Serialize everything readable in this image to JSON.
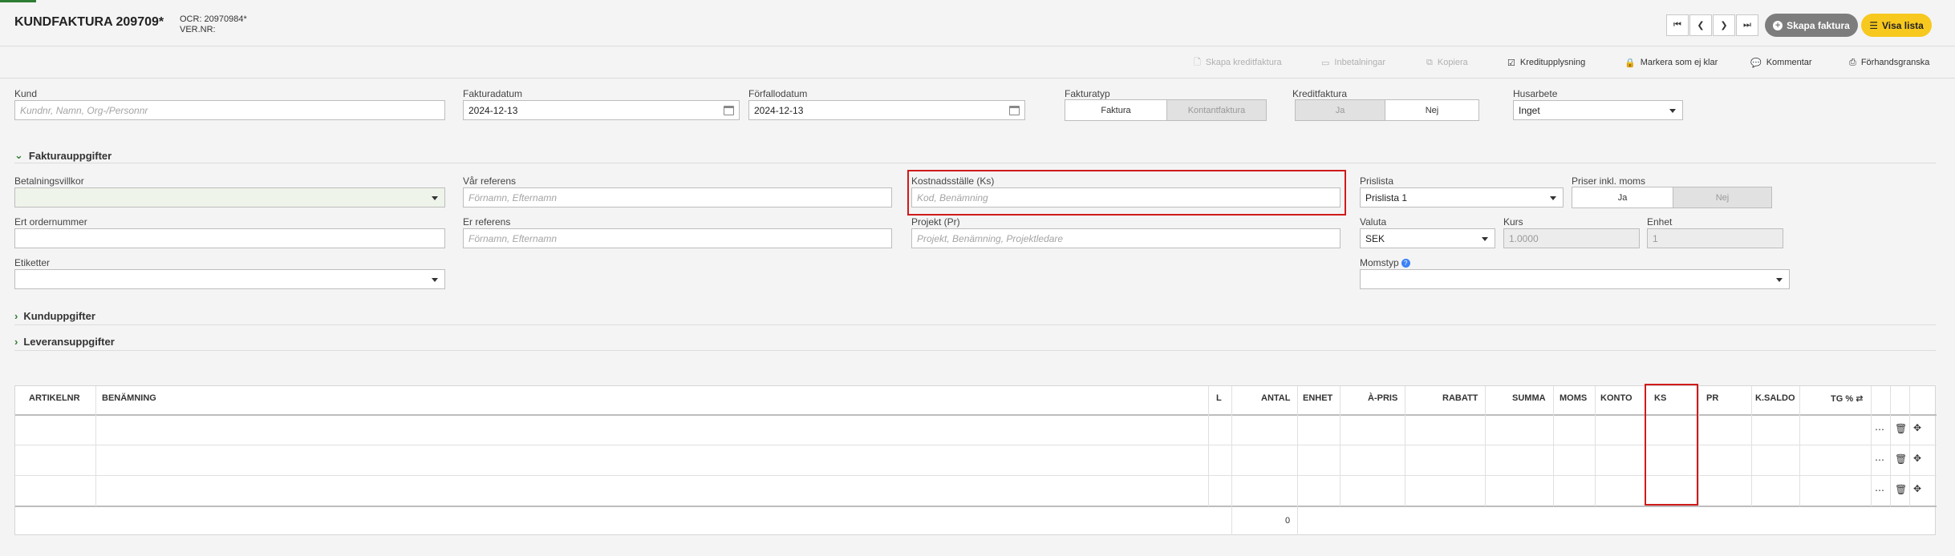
{
  "header": {
    "title": "KUNDFAKTURA 209709*",
    "ocr": "OCR: 20970984*",
    "version": "VER.NR:",
    "create_invoice_label": "Skapa faktura",
    "show_list_label": "Visa lista"
  },
  "toolbar": {
    "credit_invoice": "Skapa kreditfaktura",
    "payments": "Inbetalningar",
    "copy": "Kopiera",
    "credit_check": "Kreditupplysning",
    "mark_not_ready": "Markera som ej klar",
    "comment": "Kommentar",
    "preview": "Förhandsgranska"
  },
  "form": {
    "customer_label": "Kund",
    "customer_placeholder": "Kundnr, Namn, Org-/Personnr",
    "invoice_date_label": "Fakturadatum",
    "invoice_date": "2024-12-13",
    "due_date_label": "Förfallodatum",
    "due_date": "2024-12-13",
    "invoice_type_label": "Fakturatyp",
    "invoice_type_options": [
      "Faktura",
      "Kontantfaktura"
    ],
    "credit_invoice_label": "Kreditfaktura",
    "credit_options": [
      "Ja",
      "Nej"
    ],
    "house_work_label": "Husarbete",
    "house_work_value": "Inget"
  },
  "sections": {
    "invoice_details": "Fakturauppgifter",
    "customer_details": "Kunduppgifter",
    "delivery_details": "Leveransuppgifter"
  },
  "details": {
    "payment_terms_label": "Betalningsvillkor",
    "our_reference_label": "Vår referens",
    "our_reference_placeholder": "Förnamn, Efternamn",
    "cost_center_label": "Kostnadsställe (Ks)",
    "cost_center_placeholder": "Kod, Benämning",
    "price_list_label": "Prislista",
    "price_list_value": "Prislista 1",
    "prices_incl_vat_label": "Priser inkl. moms",
    "prices_incl_vat_options": [
      "Ja",
      "Nej"
    ],
    "your_order_label": "Ert ordernummer",
    "your_reference_label": "Er referens",
    "your_reference_placeholder": "Förnamn, Efternamn",
    "project_label": "Projekt (Pr)",
    "project_placeholder": "Projekt, Benämning, Projektledare",
    "currency_label": "Valuta",
    "currency_value": "SEK",
    "rate_label": "Kurs",
    "rate_value": "1.0000",
    "unit_label": "Enhet",
    "unit_value": "1",
    "tags_label": "Etiketter",
    "vat_type_label": "Momstyp"
  },
  "grid": {
    "columns": [
      "ARTIKELNR",
      "BENÄMNING",
      "L",
      "ANTAL",
      "ENHET",
      "À-PRIS",
      "RABATT",
      "SUMMA",
      "MOMS",
      "KONTO",
      "KS",
      "PR",
      "K.SALDO",
      "TG %"
    ],
    "total_quantity": "0"
  }
}
